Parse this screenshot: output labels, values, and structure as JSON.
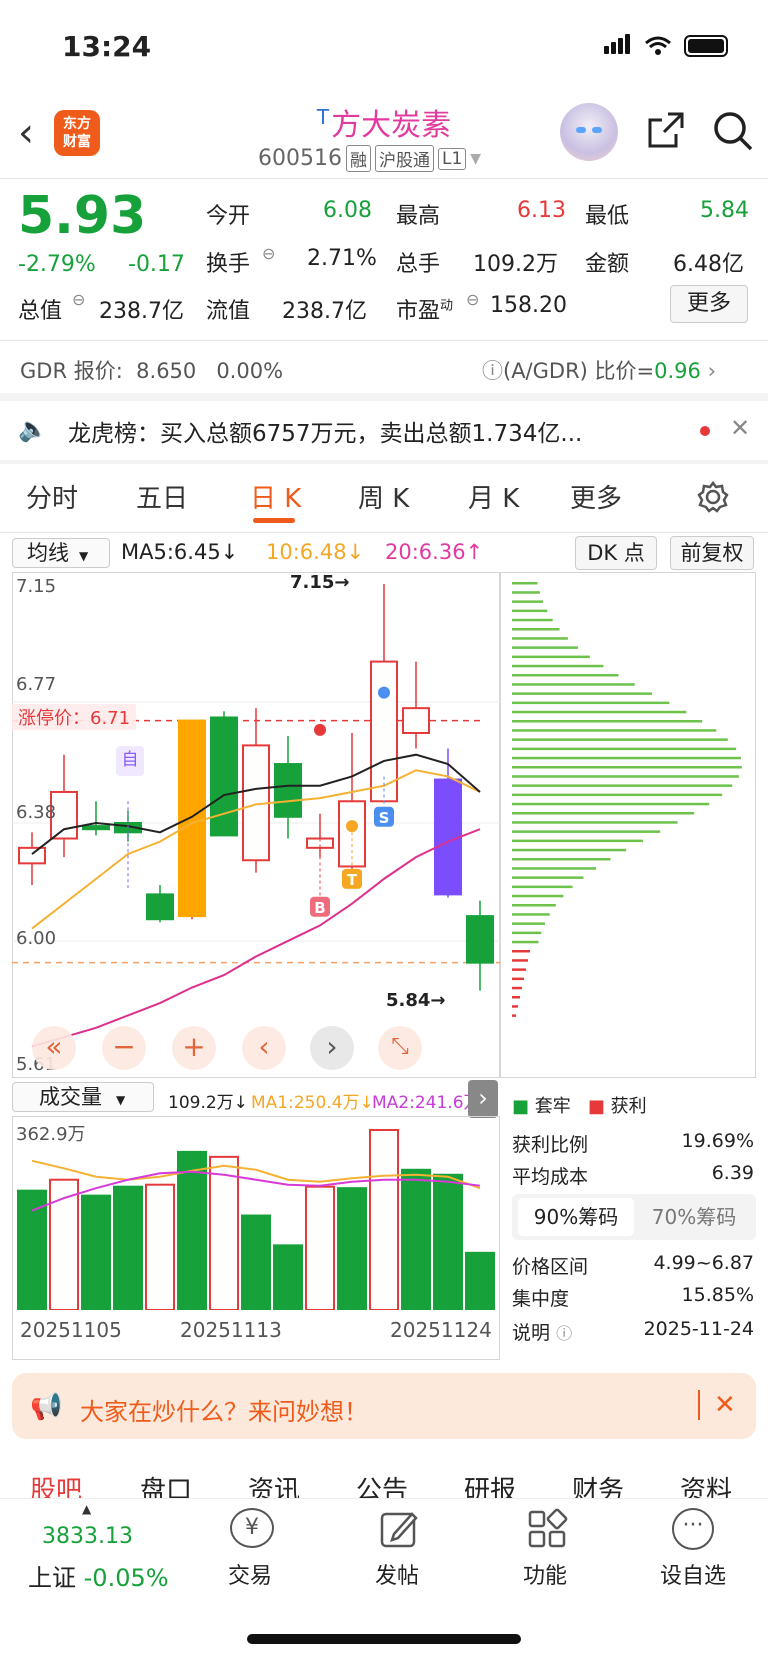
{
  "status": {
    "time": "13:24"
  },
  "header": {
    "logo_line1": "东方",
    "logo_line2": "财富",
    "title_prefix": "T",
    "title": "方大炭素",
    "code": "600516",
    "tags": [
      "融",
      "沪股通",
      "L1"
    ]
  },
  "quote": {
    "price": "5.93",
    "change_pct": "-2.79%",
    "change": "-0.17",
    "open_label": "今开",
    "open": "6.08",
    "high_label": "最高",
    "high": "6.13",
    "low_label": "最低",
    "low": "5.84",
    "turnover_label": "换手",
    "turnover": "2.71%",
    "volume_label": "总手",
    "volume": "109.2万",
    "amount_label": "金额",
    "amount": "6.48亿",
    "mktcap_label": "总值",
    "mktcap": "238.7亿",
    "float_label": "流值",
    "float": "238.7亿",
    "pe_label": "市盈",
    "pe_sup": "动",
    "pe": "158.20",
    "more": "更多"
  },
  "gdr": {
    "label": "GDR 报价:",
    "price": "8.650",
    "pct": "0.00%",
    "ratio_label": "(A/GDR) 比价=",
    "ratio": "0.96"
  },
  "notice": {
    "text": "龙虎榜：买入总额6757万元，卖出总额1.734亿..."
  },
  "tabs": [
    "分时",
    "五日",
    "日 K",
    "周 K",
    "月 K",
    "更多"
  ],
  "ma_bar": {
    "selector": "均线",
    "ma5": "MA5:6.45↓",
    "ma10": "10:6.48↓",
    "ma20": "20:6.36↑",
    "dk": "DK 点",
    "fq": "前复权"
  },
  "kchart": {
    "y_ticks": [
      "7.15",
      "6.77",
      "6.38",
      "6.00",
      "5.61"
    ],
    "limit_label": "涨停价：6.71",
    "high_annot": "7.15→",
    "low_annot": "5.84→",
    "auto_label": "自"
  },
  "chart_data": {
    "type": "candlestick",
    "ylim": [
      5.61,
      7.15
    ],
    "limit_up": 6.71,
    "candles": [
      {
        "o": 6.25,
        "c": 6.3,
        "h": 6.35,
        "l": 6.18,
        "color": "red"
      },
      {
        "o": 6.33,
        "c": 6.48,
        "h": 6.6,
        "l": 6.27,
        "color": "red"
      },
      {
        "o": 6.37,
        "c": 6.36,
        "h": 6.45,
        "l": 6.34,
        "color": "green"
      },
      {
        "o": 6.38,
        "c": 6.35,
        "h": 6.42,
        "l": 6.32,
        "color": "green"
      },
      {
        "o": 6.15,
        "c": 6.07,
        "h": 6.18,
        "l": 6.06,
        "color": "green"
      },
      {
        "o": 6.08,
        "c": 6.71,
        "h": 6.71,
        "l": 6.07,
        "color": "orange"
      },
      {
        "o": 6.72,
        "c": 6.34,
        "h": 6.74,
        "l": 6.34,
        "color": "green"
      },
      {
        "o": 6.26,
        "c": 6.63,
        "h": 6.75,
        "l": 6.22,
        "color": "red"
      },
      {
        "o": 6.57,
        "c": 6.4,
        "h": 6.66,
        "l": 6.33,
        "color": "green"
      },
      {
        "o": 6.3,
        "c": 6.33,
        "h": 6.41,
        "l": 6.27,
        "color": "red"
      },
      {
        "o": 6.24,
        "c": 6.45,
        "h": 6.67,
        "l": 6.22,
        "color": "red"
      },
      {
        "o": 6.45,
        "c": 6.9,
        "h": 7.15,
        "l": 6.45,
        "color": "red"
      },
      {
        "o": 6.67,
        "c": 6.75,
        "h": 6.9,
        "l": 6.62,
        "color": "red"
      },
      {
        "o": 6.52,
        "c": 6.15,
        "h": 6.62,
        "l": 6.14,
        "color": "purple"
      },
      {
        "o": 6.08,
        "c": 5.93,
        "h": 6.13,
        "l": 5.84,
        "color": "green"
      }
    ],
    "ma_black": [
      6.28,
      6.36,
      6.38,
      6.37,
      6.35,
      6.4,
      6.47,
      6.49,
      6.5,
      6.5,
      6.53,
      6.58,
      6.6,
      6.57,
      6.48
    ],
    "ma_yellow": [
      6.04,
      6.12,
      6.2,
      6.28,
      6.32,
      6.38,
      6.41,
      6.44,
      6.45,
      6.46,
      6.48,
      6.5,
      6.55,
      6.53,
      6.48
    ],
    "ma_pink": [
      5.66,
      5.69,
      5.72,
      5.76,
      5.8,
      5.85,
      5.89,
      5.95,
      6.0,
      6.05,
      6.12,
      6.2,
      6.27,
      6.32,
      6.36
    ],
    "volume": {
      "label": "成交量",
      "vol": "109.2万↓",
      "ma1": "MA1:250.4万↓",
      "ma2": "MA2:241.6万",
      "max_label": "362.9万",
      "values": [
        240,
        262,
        230,
        248,
        252,
        318,
        308,
        190,
        130,
        248,
        245,
        362,
        282,
        272,
        115
      ],
      "colors": [
        "green",
        "red",
        "green",
        "green",
        "red",
        "green",
        "red",
        "green",
        "green",
        "red",
        "green",
        "red",
        "green",
        "green",
        "green"
      ],
      "x_labels": [
        "20251105",
        "20251113",
        "20251124"
      ]
    }
  },
  "chips": {
    "legend_trap": "套牢",
    "legend_profit": "获利",
    "profit_ratio_label": "获利比例",
    "profit_ratio": "19.69%",
    "avg_cost_label": "平均成本",
    "avg_cost": "6.39",
    "tab90": "90%筹码",
    "tab70": "70%筹码",
    "range_label": "价格区间",
    "range": "4.99~6.87",
    "conc_label": "集中度",
    "conc": "15.85%",
    "note_label": "说明",
    "note_date": "2025-11-24"
  },
  "promo": {
    "text": "大家在炒什么？来问妙想！"
  },
  "subtabs": [
    "股吧",
    "盘口",
    "资讯",
    "公告",
    "研报",
    "财务",
    "资料"
  ],
  "bottom": {
    "index_value": "3833.13",
    "index_name": "上证",
    "index_pct": "-0.05%",
    "trade": "交易",
    "post": "发帖",
    "func": "功能",
    "watch": "设自选"
  },
  "colors": {
    "up": "#e5393a",
    "down": "#17a13a",
    "accent": "#ef5b1a"
  }
}
